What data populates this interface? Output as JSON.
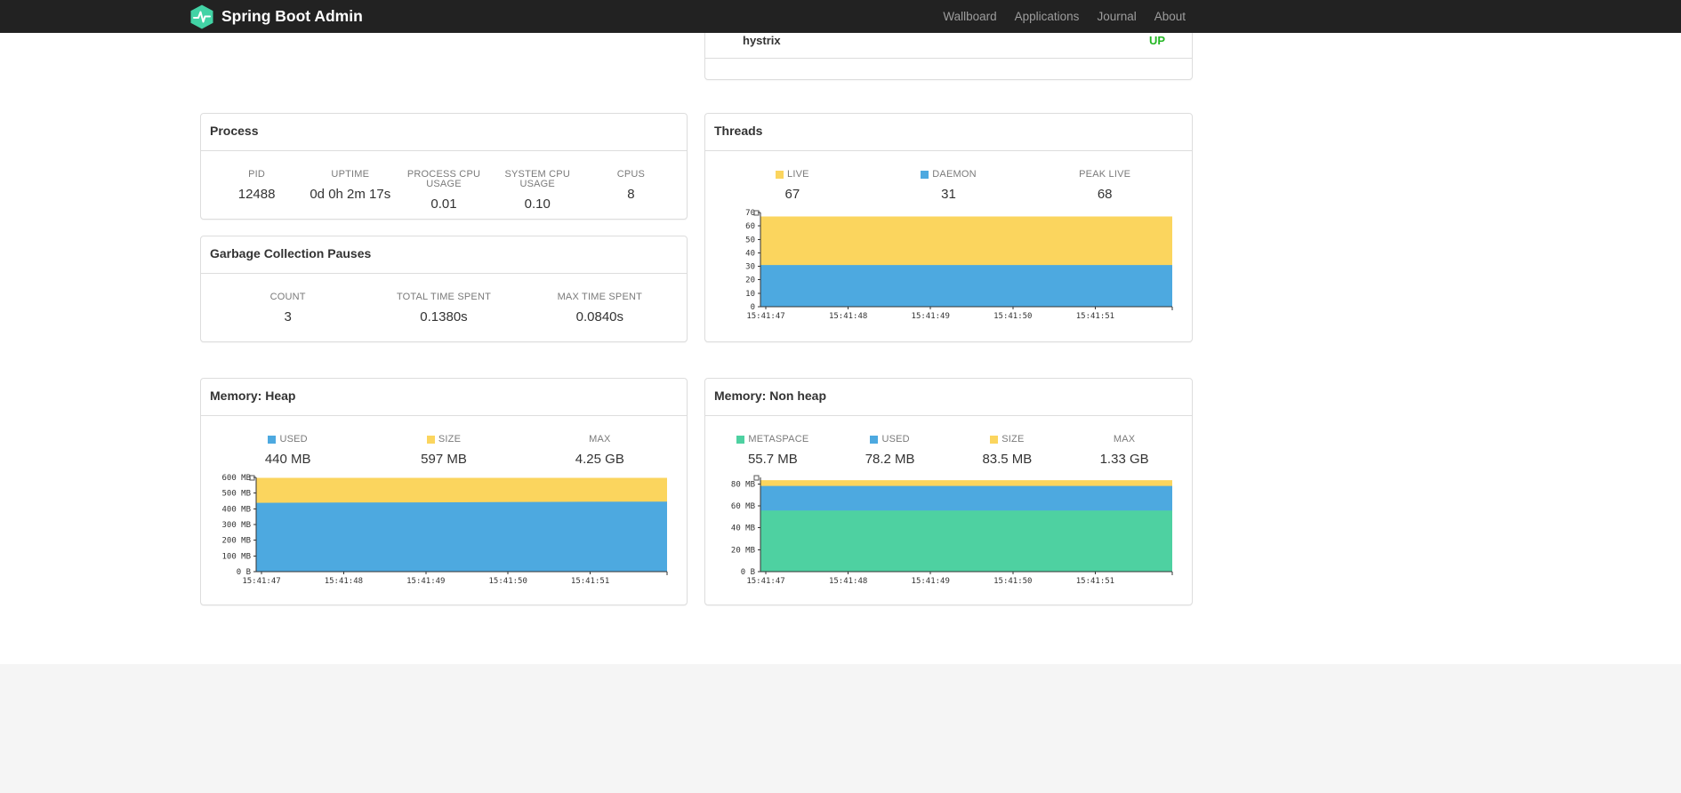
{
  "navbar": {
    "brand": "Spring Boot Admin",
    "links": [
      "Wallboard",
      "Applications",
      "Journal",
      "About"
    ]
  },
  "health_panel": {
    "row": {
      "name": "hystrix",
      "status": "UP"
    }
  },
  "panels": {
    "process": {
      "title": "Process",
      "stats": [
        {
          "label": "PID",
          "value": "12488"
        },
        {
          "label": "UPTIME",
          "value": "0d 0h 2m 17s"
        },
        {
          "label": "PROCESS CPU USAGE",
          "value": "0.01"
        },
        {
          "label": "SYSTEM CPU USAGE",
          "value": "0.10"
        },
        {
          "label": "CPUS",
          "value": "8"
        }
      ]
    },
    "gc": {
      "title": "Garbage Collection Pauses",
      "stats": [
        {
          "label": "COUNT",
          "value": "3"
        },
        {
          "label": "TOTAL TIME SPENT",
          "value": "0.1380s"
        },
        {
          "label": "MAX TIME SPENT",
          "value": "0.0840s"
        }
      ]
    },
    "threads": {
      "title": "Threads",
      "stats": [
        {
          "label": "LIVE",
          "value": "67"
        },
        {
          "label": "DAEMON",
          "value": "31"
        },
        {
          "label": "PEAK LIVE",
          "value": "68"
        }
      ]
    },
    "heap": {
      "title": "Memory: Heap",
      "stats": [
        {
          "label": "USED",
          "value": "440 MB"
        },
        {
          "label": "SIZE",
          "value": "597 MB"
        },
        {
          "label": "MAX",
          "value": "4.25 GB"
        }
      ]
    },
    "nonheap": {
      "title": "Memory: Non heap",
      "stats": [
        {
          "label": "METASPACE",
          "value": "55.7 MB"
        },
        {
          "label": "USED",
          "value": "78.2 MB"
        },
        {
          "label": "SIZE",
          "value": "83.5 MB"
        },
        {
          "label": "MAX",
          "value": "1.33 GB"
        }
      ]
    }
  },
  "colors": {
    "yellow": "#fbd55e",
    "blue": "#4da9e0",
    "green": "#4ed1a1",
    "status_up": "#24b724",
    "brand_green": "#42d3a5"
  },
  "chart_data": [
    {
      "id": "threads",
      "type": "area",
      "title": "Threads",
      "xlabel": "",
      "ylabel": "",
      "ylim": [
        0,
        70
      ],
      "grid": false,
      "legend_position": "top",
      "legend": [
        {
          "name": "LIVE",
          "color": "#fbd55e"
        },
        {
          "name": "DAEMON",
          "color": "#4da9e0"
        }
      ],
      "yticks": [
        {
          "value": 0,
          "label": "0"
        },
        {
          "value": 10,
          "label": "10"
        },
        {
          "value": 20,
          "label": "20"
        },
        {
          "value": 30,
          "label": "30"
        },
        {
          "value": 40,
          "label": "40"
        },
        {
          "value": 50,
          "label": "50"
        },
        {
          "value": 60,
          "label": "60"
        },
        {
          "value": 70,
          "label": "70"
        }
      ],
      "xticks": [
        "15:41:47",
        "15:41:48",
        "15:41:49",
        "15:41:50",
        "15:41:51"
      ],
      "xtick_fracs": [
        0.013,
        0.213,
        0.413,
        0.613,
        0.813
      ],
      "series": [
        {
          "name": "live",
          "color": "#fbd55e",
          "values": [
            67,
            67,
            67,
            67,
            67,
            67
          ]
        },
        {
          "name": "daemon",
          "color": "#4da9e0",
          "values": [
            31,
            31,
            31,
            31,
            31,
            31
          ]
        }
      ]
    },
    {
      "id": "memory-heap",
      "type": "area",
      "title": "Memory: Heap",
      "xlabel": "",
      "ylabel": "",
      "ylim": [
        0,
        600
      ],
      "grid": false,
      "legend_position": "top",
      "legend": [
        {
          "name": "USED",
          "color": "#4da9e0"
        },
        {
          "name": "SIZE",
          "color": "#fbd55e"
        }
      ],
      "yticks": [
        {
          "value": 0,
          "label": "0 B"
        },
        {
          "value": 100,
          "label": "100 MB"
        },
        {
          "value": 200,
          "label": "200 MB"
        },
        {
          "value": 300,
          "label": "300 MB"
        },
        {
          "value": 400,
          "label": "400 MB"
        },
        {
          "value": 500,
          "label": "500 MB"
        },
        {
          "value": 600,
          "label": "600 MB"
        }
      ],
      "xticks": [
        "15:41:47",
        "15:41:48",
        "15:41:49",
        "15:41:50",
        "15:41:51"
      ],
      "xtick_fracs": [
        0.013,
        0.213,
        0.413,
        0.613,
        0.813
      ],
      "series": [
        {
          "name": "size",
          "color": "#fbd55e",
          "values": [
            597,
            597,
            597,
            597,
            597,
            597
          ]
        },
        {
          "name": "used",
          "color": "#4da9e0",
          "values": [
            438,
            440,
            441,
            443,
            445,
            446
          ]
        }
      ]
    },
    {
      "id": "memory-nonheap",
      "type": "area",
      "title": "Memory: Non heap",
      "xlabel": "",
      "ylabel": "",
      "ylim": [
        0,
        86
      ],
      "grid": false,
      "legend_position": "top",
      "legend": [
        {
          "name": "METASPACE",
          "color": "#4ed1a1"
        },
        {
          "name": "USED",
          "color": "#4da9e0"
        },
        {
          "name": "SIZE",
          "color": "#fbd55e"
        }
      ],
      "yticks": [
        {
          "value": 0,
          "label": "0 B"
        },
        {
          "value": 20,
          "label": "20 MB"
        },
        {
          "value": 40,
          "label": "40 MB"
        },
        {
          "value": 60,
          "label": "60 MB"
        },
        {
          "value": 80,
          "label": "80 MB"
        }
      ],
      "xticks": [
        "15:41:47",
        "15:41:48",
        "15:41:49",
        "15:41:50",
        "15:41:51"
      ],
      "xtick_fracs": [
        0.013,
        0.213,
        0.413,
        0.613,
        0.813
      ],
      "series": [
        {
          "name": "size",
          "color": "#fbd55e",
          "values": [
            83.5,
            83.5,
            83.5,
            83.5,
            83.5,
            83.5
          ]
        },
        {
          "name": "used",
          "color": "#4da9e0",
          "values": [
            78.2,
            78.2,
            78.2,
            78.2,
            78.2,
            78.2
          ]
        },
        {
          "name": "metaspace",
          "color": "#4ed1a1",
          "values": [
            55.7,
            55.7,
            55.7,
            55.7,
            55.7,
            55.7
          ]
        }
      ]
    }
  ]
}
